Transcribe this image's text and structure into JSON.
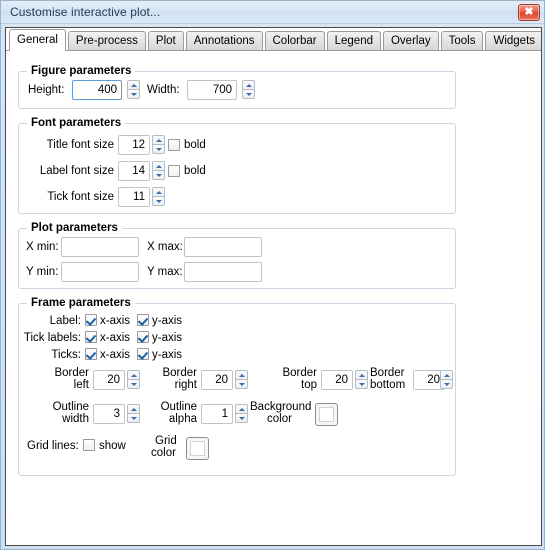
{
  "window": {
    "title": "Customise interactive plot...",
    "close_label": "✖"
  },
  "tabs": [
    {
      "label": "General",
      "active": true
    },
    {
      "label": "Pre-process",
      "active": false
    },
    {
      "label": "Plot",
      "active": false
    },
    {
      "label": "Annotations",
      "active": false
    },
    {
      "label": "Colorbar",
      "active": false
    },
    {
      "label": "Legend",
      "active": false
    },
    {
      "label": "Overlay",
      "active": false
    },
    {
      "label": "Tools",
      "active": false
    },
    {
      "label": "Widgets",
      "active": false
    }
  ],
  "figure_parameters": {
    "title": "Figure parameters",
    "height_label": "Height:",
    "height_value": "400",
    "width_label": "Width:",
    "width_value": "700"
  },
  "font_parameters": {
    "title": "Font parameters",
    "title_font_label": "Title font size",
    "title_font_value": "12",
    "title_bold_label": "bold",
    "title_bold_checked": false,
    "label_font_label": "Label font size",
    "label_font_value": "14",
    "label_bold_label": "bold",
    "label_bold_checked": false,
    "tick_font_label": "Tick font size",
    "tick_font_value": "11"
  },
  "plot_parameters": {
    "title": "Plot parameters",
    "x_min_label": "X min:",
    "x_min_value": "",
    "x_max_label": "X max:",
    "x_max_value": "",
    "y_min_label": "Y min:",
    "y_min_value": "",
    "y_max_label": "Y max:",
    "y_max_value": ""
  },
  "frame_parameters": {
    "title": "Frame parameters",
    "label_row_label": "Label:",
    "label_x_axis": "x-axis",
    "label_x_checked": true,
    "label_y_axis": "y-axis",
    "label_y_checked": true,
    "ticklabels_row_label": "Tick labels:",
    "ticklabels_x_axis": "x-axis",
    "ticklabels_x_checked": true,
    "ticklabels_y_axis": "y-axis",
    "ticklabels_y_checked": true,
    "ticks_row_label": "Ticks:",
    "ticks_x_axis": "x-axis",
    "ticks_x_checked": true,
    "ticks_y_axis": "y-axis",
    "ticks_y_checked": true,
    "border_left_label": "Border\nleft",
    "border_left_line1": "Border",
    "border_left_line2": "left",
    "border_left_value": "20",
    "border_right_line1": "Border",
    "border_right_line2": "right",
    "border_right_value": "20",
    "border_top_line1": "Border",
    "border_top_line2": "top",
    "border_top_value": "20",
    "border_bottom_line1": "Border",
    "border_bottom_line2": "bottom",
    "border_bottom_value": "20",
    "outline_width_line1": "Outline",
    "outline_width_line2": "width",
    "outline_width_value": "3",
    "outline_alpha_line1": "Outline",
    "outline_alpha_line2": "alpha",
    "outline_alpha_value": "1",
    "background_color_line1": "Background",
    "background_color_line2": "color",
    "background_color_value": "#ffffff",
    "grid_lines_label": "Grid lines:",
    "grid_show_label": "show",
    "grid_show_checked": false,
    "grid_color_line1": "Grid",
    "grid_color_line2": "color",
    "grid_color_value": "#ffffff"
  },
  "colors": {
    "accent": "#1f5fa8",
    "titlebar": "#d7e5f4",
    "close_button": "#d6442c",
    "group_border": "#cdd6e2"
  }
}
